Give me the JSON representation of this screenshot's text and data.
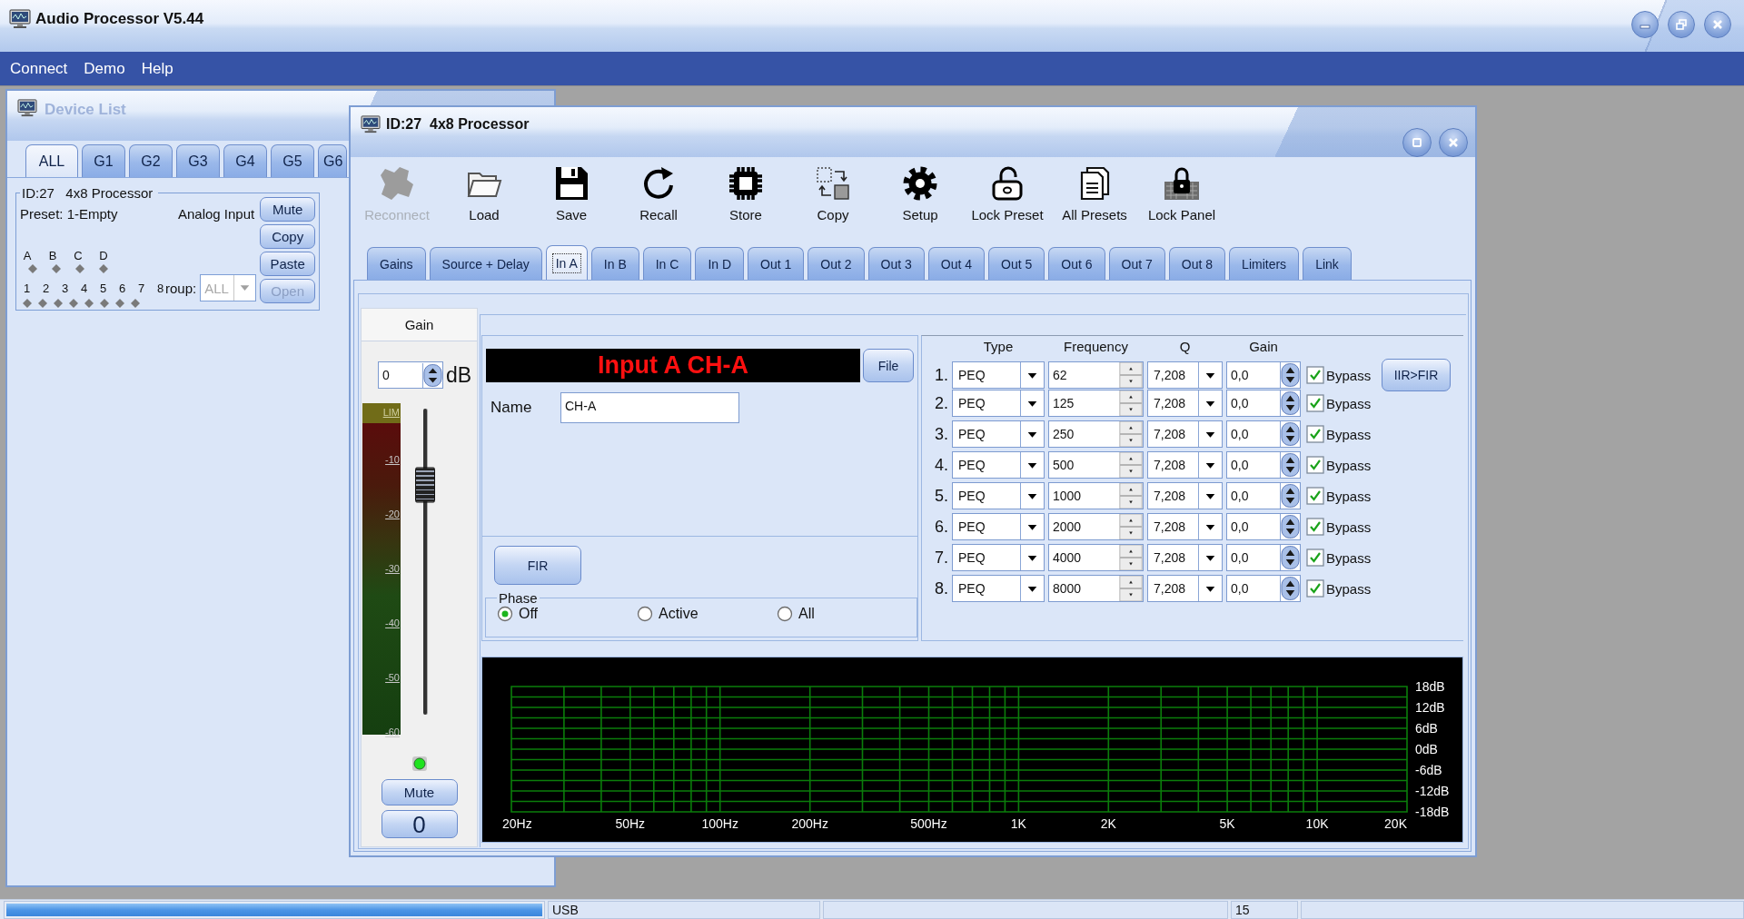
{
  "window": {
    "title": "Audio Processor V5.44"
  },
  "menu": [
    "Connect",
    "Demo",
    "Help"
  ],
  "device_list": {
    "title": "Device List",
    "tabs": [
      {
        "label": "ALL",
        "selected": true
      },
      {
        "label": "G1",
        "selected": false
      },
      {
        "label": "G2",
        "selected": false
      },
      {
        "label": "G3",
        "selected": false
      },
      {
        "label": "G4",
        "selected": false
      },
      {
        "label": "G5",
        "selected": false
      },
      {
        "label": "G6",
        "selected": false
      }
    ],
    "device": {
      "title": "ID:27   4x8 Processor",
      "preset": "Preset: 1-Empty",
      "source": "Analog Input",
      "inputs": [
        "A",
        "B",
        "C",
        "D"
      ],
      "outputs": [
        "1",
        "2",
        "3",
        "4",
        "5",
        "6",
        "7",
        "8"
      ],
      "group": {
        "label": "roup:",
        "value": "ALL",
        "disabled": true
      },
      "buttons": [
        {
          "label": "Mute",
          "disabled": false
        },
        {
          "label": "Copy",
          "disabled": false
        },
        {
          "label": "Paste",
          "disabled": false
        },
        {
          "label": "Open",
          "disabled": true
        }
      ]
    }
  },
  "processor": {
    "title": "ID:27  4x8 Processor",
    "toolbar": [
      {
        "label": "Reconnect",
        "kind": "reconnect",
        "disabled": true
      },
      {
        "label": "Load",
        "kind": "load",
        "disabled": false
      },
      {
        "label": "Save",
        "kind": "save",
        "disabled": false
      },
      {
        "label": "Recall",
        "kind": "recall",
        "disabled": false
      },
      {
        "label": "Store",
        "kind": "store",
        "disabled": false
      },
      {
        "label": "Copy",
        "kind": "copy",
        "disabled": false
      },
      {
        "label": "Setup",
        "kind": "setup",
        "disabled": false
      },
      {
        "label": "Lock Preset",
        "kind": "lock_preset",
        "disabled": false
      },
      {
        "label": "All Presets",
        "kind": "all_presets",
        "disabled": false
      },
      {
        "label": "Lock Panel",
        "kind": "lock_panel",
        "disabled": false
      }
    ],
    "tabs": [
      {
        "label": "Gains",
        "selected": false
      },
      {
        "label": "Source + Delay",
        "selected": false
      },
      {
        "label": "In A",
        "selected": true
      },
      {
        "label": "In B",
        "selected": false
      },
      {
        "label": "In C",
        "selected": false
      },
      {
        "label": "In D",
        "selected": false
      },
      {
        "label": "Out 1",
        "selected": false
      },
      {
        "label": "Out 2",
        "selected": false
      },
      {
        "label": "Out 3",
        "selected": false
      },
      {
        "label": "Out 4",
        "selected": false
      },
      {
        "label": "Out 5",
        "selected": false
      },
      {
        "label": "Out 6",
        "selected": false
      },
      {
        "label": "Out 7",
        "selected": false
      },
      {
        "label": "Out 8",
        "selected": false
      },
      {
        "label": "Limiters",
        "selected": false
      },
      {
        "label": "Link",
        "selected": false
      }
    ],
    "gain": {
      "title": "Gain",
      "value": "0",
      "unit": "dB",
      "meter_scale": [
        "LIM",
        "-10",
        "-20",
        "-30",
        "-40",
        "-50",
        "-60"
      ],
      "fader": {
        "level": 0.75
      },
      "signal_led": {
        "on": true
      },
      "mute_button": "Mute",
      "readout": "0"
    },
    "channel": {
      "banner": "Input A CH-A",
      "file_button": "File",
      "name_label": "Name",
      "name": "CH-A",
      "fir_button": "FIR",
      "phase": {
        "title": "Phase",
        "options": [
          {
            "label": "Off",
            "selected": true
          },
          {
            "label": "Active",
            "selected": false
          },
          {
            "label": "All",
            "selected": false
          }
        ]
      }
    },
    "eq": {
      "columns": [
        "Type",
        "Frequency",
        "Q",
        "Gain"
      ],
      "bands": [
        {
          "number": "1.",
          "type": "PEQ",
          "frequency": "62",
          "q": "7,208",
          "gain": "0,0",
          "bypass": true,
          "bypass_label": "Bypass"
        },
        {
          "number": "2.",
          "type": "PEQ",
          "frequency": "125",
          "q": "7,208",
          "gain": "0,0",
          "bypass": true,
          "bypass_label": "Bypass"
        },
        {
          "number": "3.",
          "type": "PEQ",
          "frequency": "250",
          "q": "7,208",
          "gain": "0,0",
          "bypass": true,
          "bypass_label": "Bypass"
        },
        {
          "number": "4.",
          "type": "PEQ",
          "frequency": "500",
          "q": "7,208",
          "gain": "0,0",
          "bypass": true,
          "bypass_label": "Bypass"
        },
        {
          "number": "5.",
          "type": "PEQ",
          "frequency": "1000",
          "q": "7,208",
          "gain": "0,0",
          "bypass": true,
          "bypass_label": "Bypass"
        },
        {
          "number": "6.",
          "type": "PEQ",
          "frequency": "2000",
          "q": "7,208",
          "gain": "0,0",
          "bypass": true,
          "bypass_label": "Bypass"
        },
        {
          "number": "7.",
          "type": "PEQ",
          "frequency": "4000",
          "q": "7,208",
          "gain": "0,0",
          "bypass": true,
          "bypass_label": "Bypass"
        },
        {
          "number": "8.",
          "type": "PEQ",
          "frequency": "8000",
          "q": "7,208",
          "gain": "0,0",
          "bypass": true,
          "bypass_label": "Bypass"
        }
      ],
      "convert_button": "IIR>FIR"
    },
    "response": {
      "x_labels": [
        "20Hz",
        "50Hz",
        "100Hz",
        "200Hz",
        "500Hz",
        "1K",
        "2K",
        "5K",
        "10K",
        "20K"
      ],
      "y_labels": [
        "18dB",
        "12dB",
        "6dB",
        "0dB",
        "-6dB",
        "-12dB",
        "-18dB"
      ]
    }
  },
  "status_bar": {
    "progress": {
      "level": 1
    },
    "connection": "USB",
    "count": "15"
  }
}
